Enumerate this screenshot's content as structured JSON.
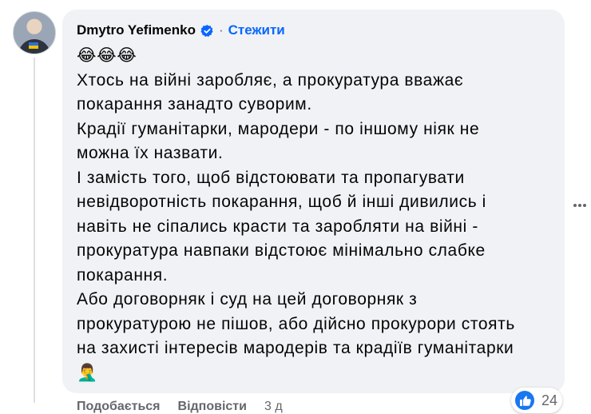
{
  "comment": {
    "author": "Dmytro Yefimenko",
    "separator": "·",
    "follow_label": "Стежити",
    "emoji_line": "😂😂😂",
    "text": "Хтось на війні заробляє, а прокуратура вважає\nпокарання занадто суворим.\nКрадії гуманітарки, мародери - по іншому ніяк не\nможна їх назвати.\nІ замість того, щоб відстоювати та пропагувати\nневідворотність покарання, щоб й інші дивились і\nнавіть не сіпались красти та заробляти на війні -\nпрокуратура навпаки відстоює мінімально слабке\nпокарання.\nАбо договорняк і суд на цей договорняк з\nпрокуратурою не пішов, або дійсно прокурори стоять\nна захисті інтересів мародерів та крадіїв гуманітарки",
    "trailing_emoji": "🤦‍♂️",
    "reaction_count": "24",
    "actions": {
      "like_label": "Подобається",
      "reply_label": "Відповісти",
      "time": "3 д"
    }
  },
  "colors": {
    "bubble": "#f0f2f5",
    "accent": "#0866ff",
    "muted": "#65676b"
  },
  "icons": {
    "verified": "verified-badge-icon",
    "like": "like-reaction-icon",
    "more": "more-options-icon"
  }
}
